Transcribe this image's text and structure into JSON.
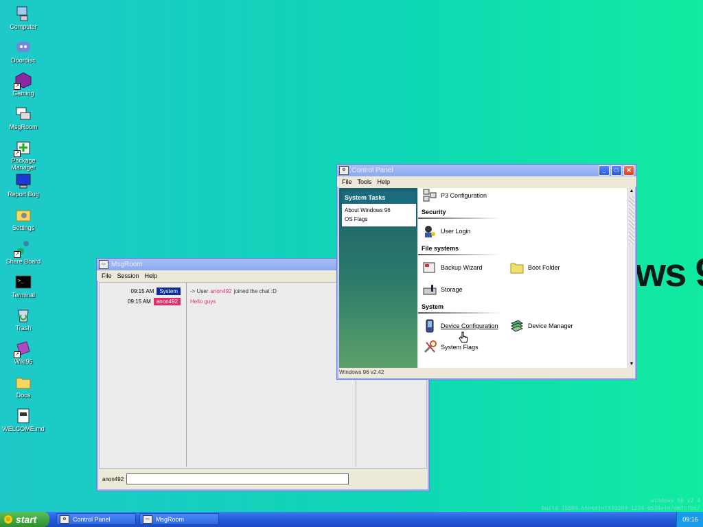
{
  "desktop": {
    "icons": [
      {
        "label": "Computer",
        "icon": "computer-icon"
      },
      {
        "label": "Doordisc",
        "icon": "discord-icon"
      },
      {
        "label": "Gaming",
        "icon": "gaming-icon"
      },
      {
        "label": "MsgRoom",
        "icon": "msgroom-icon"
      },
      {
        "label": "Package Manager",
        "icon": "package-icon"
      },
      {
        "label": "Report Bug",
        "icon": "monitor-icon"
      },
      {
        "label": "Settings",
        "icon": "settings-folder-icon"
      },
      {
        "label": "Share Board",
        "icon": "share-icon"
      },
      {
        "label": "Terminal",
        "icon": "terminal-icon"
      },
      {
        "label": "Trash",
        "icon": "trash-icon"
      },
      {
        "label": "Wiki96",
        "icon": "book-icon"
      },
      {
        "label": "Docs",
        "icon": "folder-icon"
      },
      {
        "label": "WELCOME.md",
        "icon": "document-icon"
      }
    ],
    "wallpaper_text": "ws 9",
    "build_line1": "windows 96 v2.4",
    "build_line2": "build 15504.nnnkdjn(t1010d-1224-0534e)n/nmfcfbc/"
  },
  "msgroom": {
    "title": "MsgRoom",
    "menu": [
      "File",
      "Session",
      "Help"
    ],
    "rows": [
      {
        "time": "09:15 AM",
        "user": "System",
        "type": "sys"
      },
      {
        "time": "09:15 AM",
        "user": "anon492",
        "type": "user"
      }
    ],
    "messages": {
      "m1_prefix": "-> User",
      "m1_user": "anon492",
      "m1_suffix": "joined the chat :D",
      "m2": "Hello guys"
    },
    "nick": "anon492",
    "input_value": ""
  },
  "controlpanel": {
    "title": "Control Panel",
    "menu": [
      "File",
      "Tools",
      "Help"
    ],
    "tasks_header": "System Tasks",
    "tasks": [
      "About Windows 96",
      "OS Flags"
    ],
    "items": {
      "p3": "P3 Configuration",
      "security": "Security",
      "user_login": "User Login",
      "file_systems": "File systems",
      "backup": "Backup Wizard",
      "boot_folder": "Boot Folder",
      "storage": "Storage",
      "system": "System",
      "device_config": "Device Configuration",
      "device_manager": "Device Manager",
      "system_flags": "System Flags"
    },
    "status": "Windows 96 v2.42"
  },
  "taskbar": {
    "start": "start",
    "tasks": [
      "Control Panel",
      "MsgRoom"
    ],
    "clock": "09:16"
  },
  "colors": {
    "accent": "#235ad8",
    "system_badge": "#0a2c9a",
    "user_badge": "#e0306a"
  }
}
